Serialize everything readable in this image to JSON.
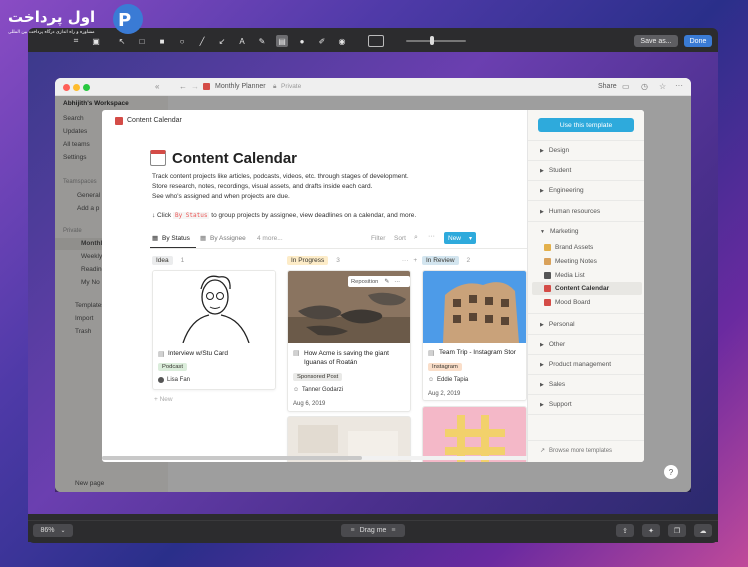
{
  "toolbar": {
    "save_as_label": "Save as...",
    "done_label": "Done"
  },
  "logo": {
    "text": "اول پرداخت",
    "subtitle": "مشاوره و راه اندازی درگاه پرداخت بین المللی"
  },
  "inner_window": {
    "title": "Monthly Planner",
    "privacy": "Private",
    "share_label": "Share",
    "new_page_label": "New page"
  },
  "sidebar": {
    "workspace": "Abhijith's Workspace",
    "items_top": [
      "Search",
      "Updates",
      "All teams",
      "Settings"
    ],
    "teamspaces_label": "Teamspaces",
    "teamspace_items": [
      "General",
      "Add a p"
    ],
    "private_label": "Private",
    "private_items": [
      "Monthly",
      "Weekly",
      "Reading",
      "My No"
    ],
    "bottom_items": [
      "Templates",
      "Import",
      "Trash"
    ]
  },
  "modal": {
    "breadcrumb": "Content Calendar",
    "use_template_label": "Use this template",
    "title": "Content Calendar",
    "desc_line1": "Track content projects like articles, podcasts, videos, etc. through stages of development.",
    "desc_line2": "Store research, notes, recordings, visual assets, and drafts inside each card.",
    "desc_line3": "See who's assigned and when projects are due.",
    "hint_pre": "↓ Click",
    "hint_code": "By Status",
    "hint_post": "to group projects by assignee, view deadlines on a calendar, and more.",
    "views": {
      "by_status": "By Status",
      "by_assignee": "By Assignee",
      "more": "4 more..."
    },
    "controls": {
      "filter": "Filter",
      "sort": "Sort",
      "new": "New"
    },
    "columns": [
      {
        "name": "Idea",
        "count": "1",
        "color": "#ebeced"
      },
      {
        "name": "In Progress",
        "count": "3",
        "color": "#fdecc8"
      },
      {
        "name": "In Review",
        "count": "2",
        "color": "#d3e5ef"
      }
    ],
    "cards": [
      {
        "title": "Interview w/Stu Card",
        "tag": "Podcast",
        "tag_color": "#dbeddb",
        "person": "Lisa Fan",
        "date": ""
      },
      {
        "title": "How Acme is saving the giant Iguanas of Roatán",
        "tag": "Sponsored Post",
        "tag_color": "#e9e9e7",
        "person": "Tanner Godarzi",
        "date": "Aug 6, 2019",
        "reposition": "Reposition"
      },
      {
        "title": "Team Trip - Instagram Stor",
        "tag": "Instagram",
        "tag_color": "#fadec9",
        "person": "Eddie Tapia",
        "date": "Aug 2, 2019"
      }
    ],
    "new_label": "New"
  },
  "template_sidebar": {
    "categories_top": [
      "Design",
      "Student",
      "Engineering",
      "Human resources",
      "Marketing"
    ],
    "marketing_items": [
      {
        "label": "Brand Assets",
        "color": "#e3b04b"
      },
      {
        "label": "Meeting Notes",
        "color": "#d9a15a"
      },
      {
        "label": "Media List",
        "color": "#555555"
      },
      {
        "label": "Content Calendar",
        "color": "#d44c47"
      },
      {
        "label": "Mood Board",
        "color": "#d44c47"
      }
    ],
    "categories_bottom": [
      "Personal",
      "Other",
      "Product management",
      "Sales",
      "Support"
    ],
    "browse_label": "Browse more templates"
  },
  "bottom_bar": {
    "zoom": "86%",
    "drag_label": "Drag me"
  },
  "help_label": "?"
}
